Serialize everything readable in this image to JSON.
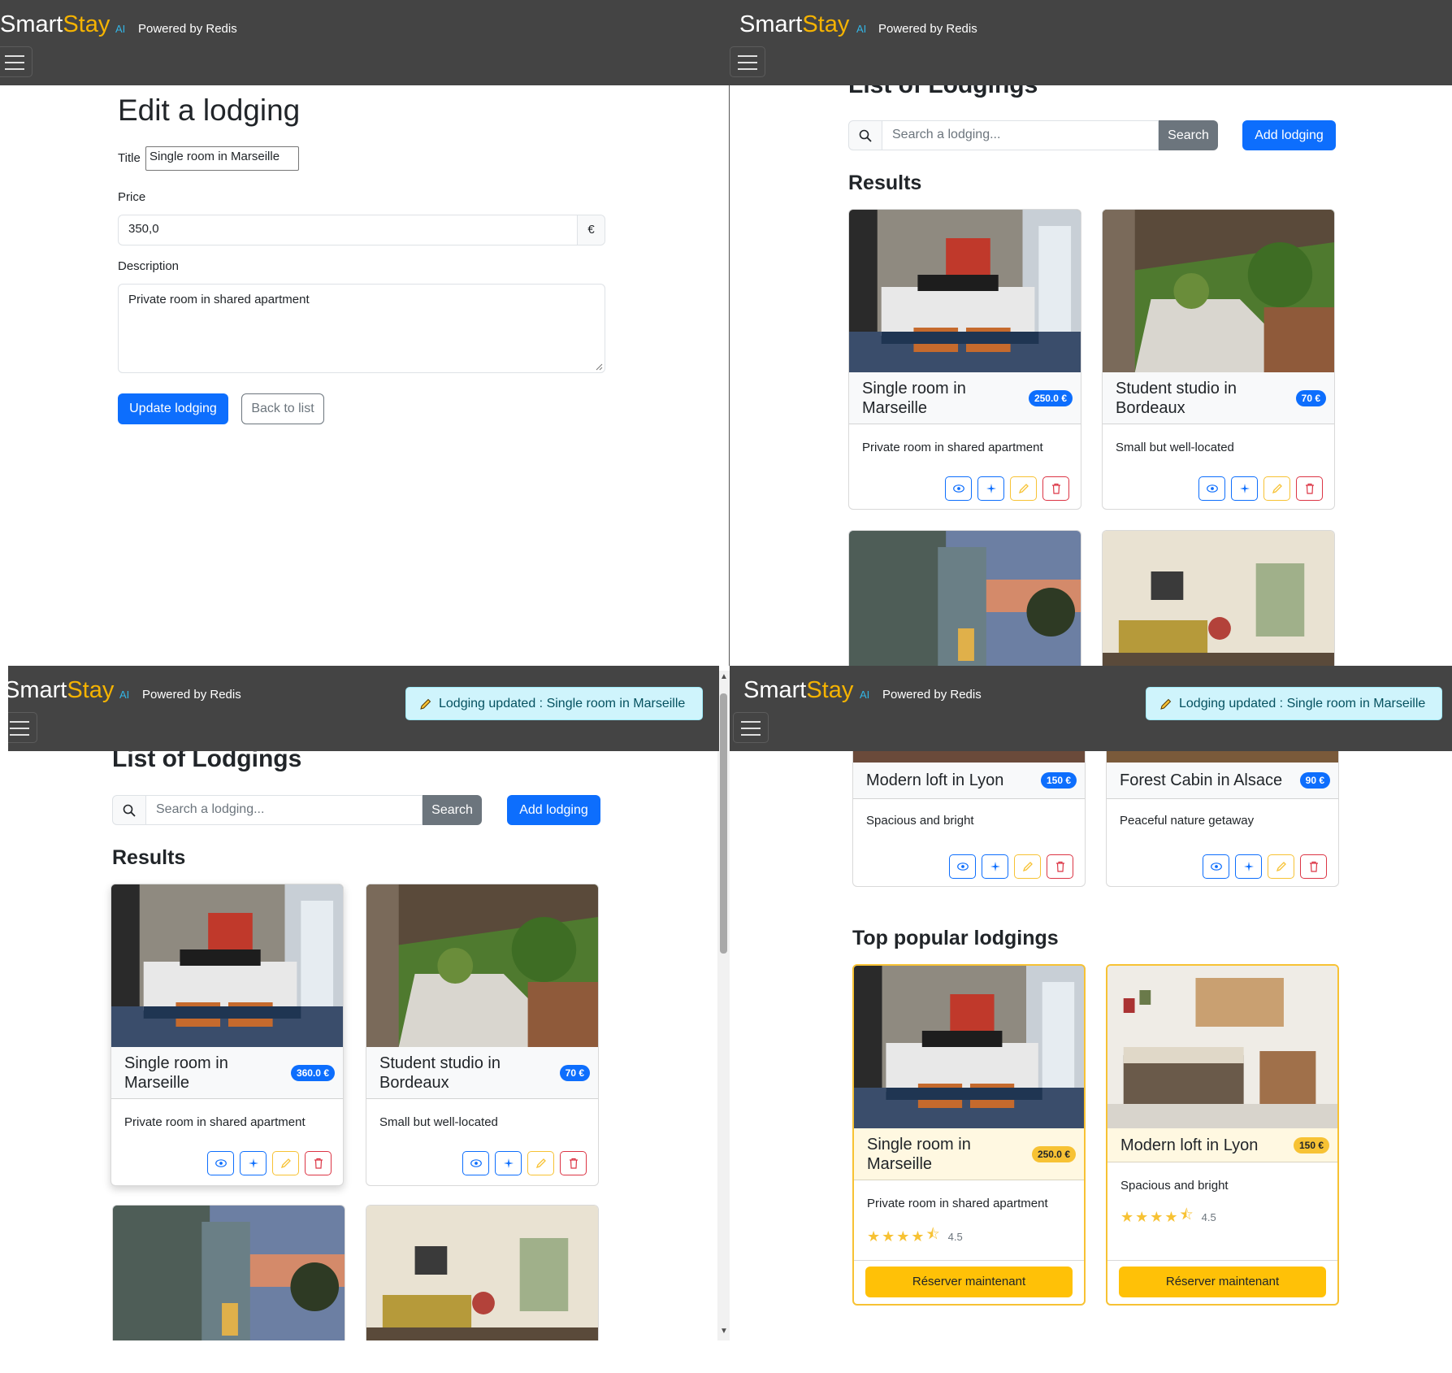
{
  "brand": {
    "smart": "Smart",
    "stay": "Stay",
    "ai": "AI",
    "powered": "Powered by Redis"
  },
  "toast": {
    "text": "Lodging updated : Single room in Marseille"
  },
  "edit": {
    "heading": "Edit a lodging",
    "title_label": "Title",
    "title_value": "Single room in Marseille",
    "price_label": "Price",
    "price_value": "350,0",
    "currency": "€",
    "description_label": "Description",
    "description_value": "Private room in shared apartment",
    "update_label": "Update lodging",
    "back_label": "Back to list"
  },
  "list": {
    "heading": "List of Lodgings",
    "search_placeholder": "Search a lodging...",
    "search_label": "Search",
    "add_label": "Add lodging",
    "results_heading": "Results",
    "popular_heading": "Top popular lodgings",
    "reserve_label": "Réserver maintenant"
  },
  "cards_before": [
    {
      "title": "Single room in Marseille",
      "price": "250.0 €",
      "description": "Private room in shared apartment"
    },
    {
      "title": "Student studio in Bordeaux",
      "price": "70 €",
      "description": "Small but well-located"
    }
  ],
  "cards_after": [
    {
      "title": "Single room in Marseille",
      "price": "360.0 €",
      "description": "Private room in shared apartment"
    },
    {
      "title": "Student studio in Bordeaux",
      "price": "70 €",
      "description": "Small but well-located"
    }
  ],
  "cards_scrolled": [
    {
      "title": "Modern loft in Lyon",
      "price": "150 €",
      "description": "Spacious and bright"
    },
    {
      "title": "Forest Cabin in Alsace",
      "price": "90 €",
      "description": "Peaceful nature getaway"
    }
  ],
  "popular": [
    {
      "title": "Single room in Marseille",
      "price": "250.0 €",
      "description": "Private room in shared apartment",
      "rating": "4.5"
    },
    {
      "title": "Modern loft in Lyon",
      "price": "150 €",
      "description": "Spacious and bright",
      "rating": "4.5"
    }
  ],
  "icons": [
    "search-icon",
    "eye-icon",
    "sparkle-icon",
    "pencil-icon",
    "trash-icon",
    "star-icon",
    "star-half-icon",
    "menu-icon"
  ],
  "colors": {
    "navbar": "#444444",
    "brand_accent": "#f5b301",
    "primary": "#0d6efd",
    "warning": "#ffc107",
    "danger": "#dc3545",
    "info_bg": "#cff4fc"
  }
}
